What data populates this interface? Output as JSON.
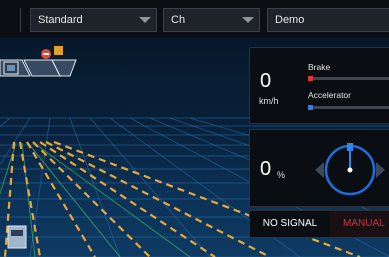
{
  "toolbar": {
    "mode_select": "Standard",
    "vehicle_select": "Ch",
    "scenario_select": "Demo"
  },
  "speed_panel": {
    "speed_value": "0",
    "speed_unit": "km/h",
    "brake_label": "Brake",
    "brake_level": 0,
    "accelerator_label": "Accelerator",
    "accelerator_level": 0
  },
  "steering_panel": {
    "steering_value": "0",
    "steering_unit": "%"
  },
  "status_bar": {
    "signal_label": "NO SIGNAL",
    "drive_mode_label": "MANUAL"
  },
  "colors": {
    "brake": "#d9363e",
    "accelerator": "#2f7de1",
    "lane_marking": "#e8a83a",
    "manual_mode": "#c2373f",
    "steering_ring": "#1e6fd9"
  },
  "icons": [
    "dropdown-arrow-icon",
    "steering-wheel-icon",
    "left-arrow-icon",
    "right-arrow-icon",
    "vehicle-icon",
    "traffic-cone-icon",
    "stop-sign-icon"
  ]
}
